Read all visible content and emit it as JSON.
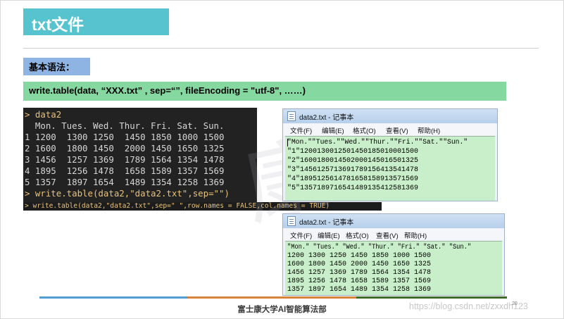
{
  "slide": {
    "title": "txt文件",
    "section_label": "基本语法：",
    "syntax": "write.table(data, “XXX.txt” , sep=“”, fileEncoding = \"utf-8\", ……)",
    "footer": "富士康大学AI智能算法部",
    "page_number": "20",
    "watermark_url": "https://blog.csdn.net/zxxdh123",
    "watermark_logo": "康"
  },
  "console": {
    "lines": [
      "> data2",
      "  Mon. Tues. Wed. Thur. Fri. Sat. Sun.",
      "1 1200  1300 1250  1450 1850 1000 1500",
      "2 1600  1800 1450  2000 1450 1650 1325",
      "3 1456  1257 1369  1789 1564 1354 1478",
      "4 1895  1256 1478  1658 1589 1357 1569",
      "5 1357  1897 1654  1489 1354 1258 1369",
      "> write.table(data2,\"data2.txt\",sep=\"\")"
    ],
    "command2": "> write.table(data2,\"data2.txt\",sep=\" \",row.names = FALSE,col.names = TRUE)"
  },
  "notepad1": {
    "title": "data2.txt - 记事本",
    "menu": [
      "文件(F)",
      "编辑(E)",
      "格式(O)",
      "查看(V)",
      "帮助(H)"
    ],
    "lines": [
      "\"Mon.\"\"Tues.\"\"Wed.\"\"Thur.\"\"Fri.\"\"Sat.\"\"Sun.\"",
      "\"1\"1200130012501450185010001500",
      "\"2\"1600180014502000145016501325",
      "\"3\"1456125713691789156413541478",
      "\"4\"1895125614781658158913571569",
      "\"5\"1357189716541489135412581369"
    ]
  },
  "notepad2": {
    "title": "data2.txt - 记事本",
    "menu": [
      "文件(F)",
      "编辑(E)",
      "格式(O)",
      "查看(V)",
      "帮助(H)"
    ],
    "lines": [
      "\"Mon.\" \"Tues.\" \"Wed.\" \"Thur.\" \"Fri.\" \"Sat.\" \"Sun.\"",
      "1200 1300 1250 1450 1850 1000 1500",
      "1600 1800 1450 2000 1450 1650 1325",
      "1456 1257 1369 1789 1564 1354 1478",
      "1895 1256 1478 1658 1589 1357 1569",
      "1357 1897 1654 1489 1354 1258 1369"
    ]
  },
  "colors": {
    "title_bg": "#56c3cf",
    "label_bg": "#8eb4e3",
    "code_bg": "#85d8a0",
    "footer_blue": "#4f9fd4",
    "footer_orange": "#d9833a",
    "footer_green": "#3f6b2a"
  }
}
